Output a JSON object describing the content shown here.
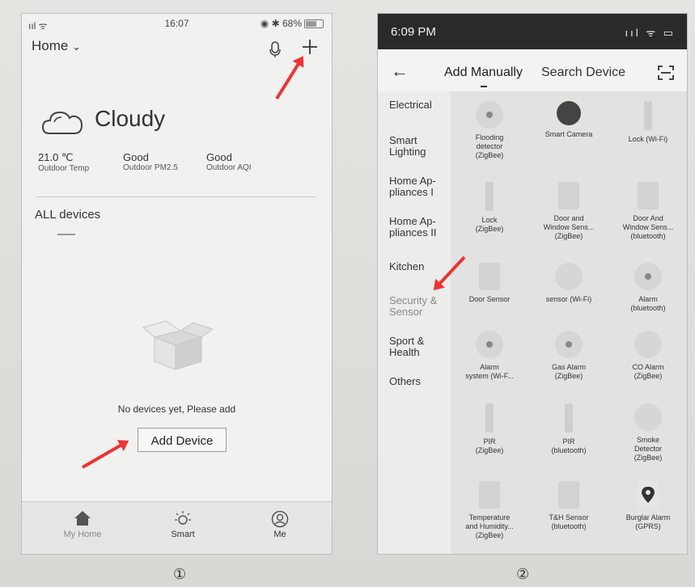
{
  "phone1": {
    "status": {
      "carrier": "ııl  ᯤ",
      "time": "16:07",
      "right": "◉ ✱ 68%"
    },
    "header": {
      "home_label": "Home",
      "chevron": "⌄",
      "mic_icon": "mic-icon",
      "plus_icon": "plus-icon"
    },
    "weather": {
      "condition": "Cloudy",
      "stats": [
        {
          "value": "21.0 ℃",
          "label": "Outdoor Temp"
        },
        {
          "value": "Good",
          "label": "Outdoor PM2.5"
        },
        {
          "value": "Good",
          "label": "Outdoor AQI"
        }
      ]
    },
    "section_title": "ALL devices",
    "empty_message": "No devices yet, Please add",
    "add_button": "Add Device",
    "tabbar": [
      {
        "icon": "home-icon",
        "label": "My Home"
      },
      {
        "icon": "smart-icon",
        "label": "Smart"
      },
      {
        "icon": "me-icon",
        "label": "Me"
      }
    ]
  },
  "phone2": {
    "status": {
      "time": "6:09 PM",
      "right": "ııl ᯤ ▭"
    },
    "header": {
      "back": "←",
      "tab_manual": "Add Manually",
      "tab_search": "Search Device",
      "scan_icon": "scan-icon"
    },
    "categories": [
      "Electrical",
      "Smart\nLighting",
      "Home Ap-\npliances I",
      "Home Ap-\npliances II",
      "Kitchen",
      "Security &\nSensor",
      "Sport &\nHealth",
      "Others"
    ],
    "devices": [
      "Flooding\ndetector\n(ZigBee)",
      "Smart Camera",
      "Lock (Wi-Fi)",
      "Lock\n(ZigBee)",
      "Door and\nWindow Sens...\n(ZigBee)",
      "Door And\nWindow Sens...\n(bluetooth)",
      "Door Sensor",
      "sensor (Wi-Fi)",
      "Alarm\n(bluetooth)",
      "Alarm\nsystem (Wi-F...",
      "Gas Alarm\n(ZigBee)",
      "CO Alarm\n(ZigBee)",
      "PIR\n(ZigBee)",
      "PIR\n(bluetooth)",
      "Smoke\nDetector\n(ZigBee)",
      "Temperature\nand Humidity...\n(ZigBee)",
      "T&H Sensor\n(bluetooth)",
      "Burglar Alarm\n(GPRS)"
    ]
  },
  "captions": [
    "①",
    "②"
  ],
  "colors": {
    "arrow": "#e33333",
    "status_bar_dark": "#2a2a2a"
  }
}
